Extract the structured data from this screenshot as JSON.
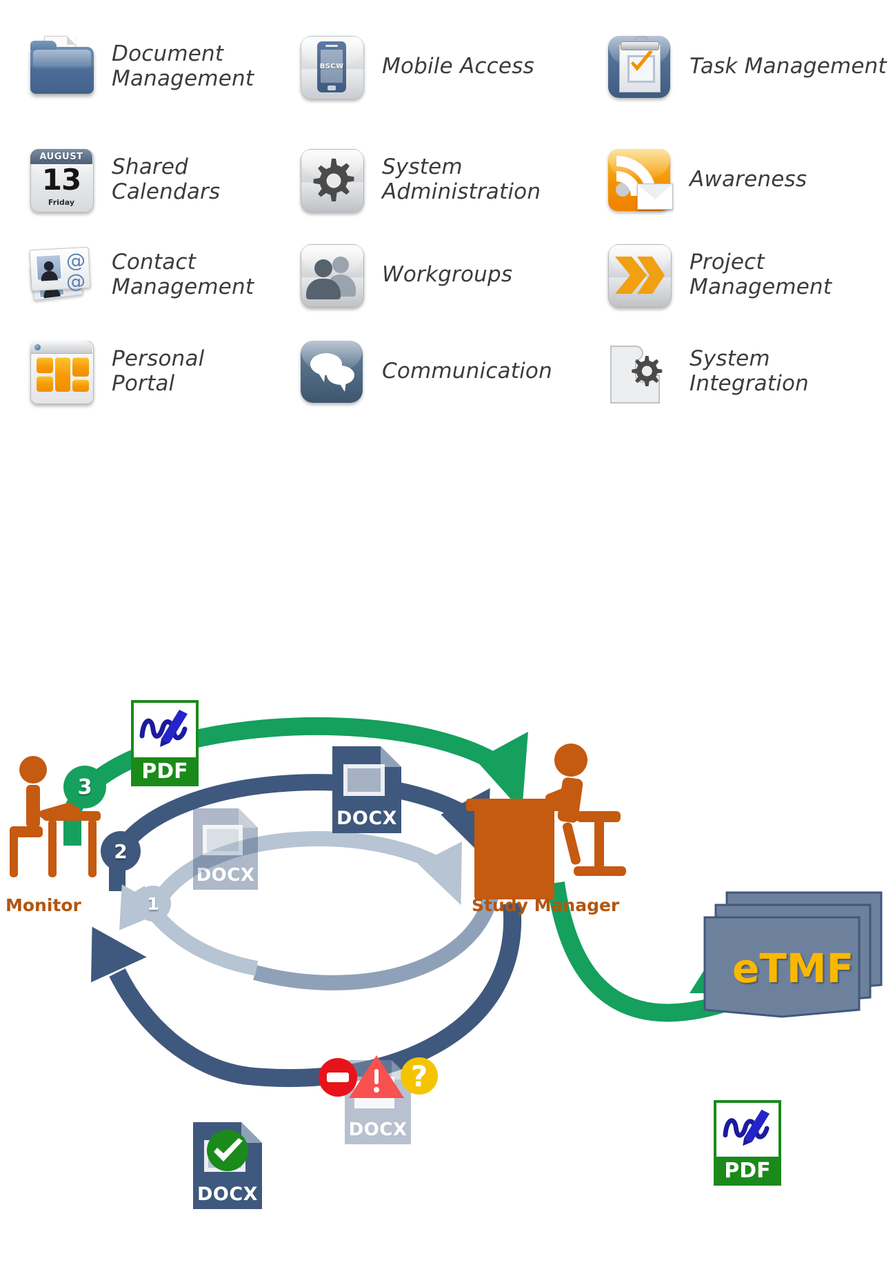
{
  "feature_grid": {
    "items": [
      {
        "id": "document-management",
        "icon": "folder-document-icon",
        "label": "Document\nManagement",
        "col": 0,
        "row": 0
      },
      {
        "id": "mobile-access",
        "icon": "mobile-phone-icon",
        "label": "Mobile Access",
        "col": 1,
        "row": 0,
        "device_brand": "BSCW"
      },
      {
        "id": "task-management",
        "icon": "clipboard-checkmark-icon",
        "label": "Task Management",
        "col": 2,
        "row": 0
      },
      {
        "id": "shared-calendars",
        "icon": "calendar-icon",
        "label": "Shared\nCalendars",
        "col": 0,
        "row": 1,
        "calendar": {
          "month": "AUGUST",
          "day": "13",
          "weekday": "Friday"
        }
      },
      {
        "id": "system-administration",
        "icon": "gear-icon",
        "label": "System\nAdministration",
        "col": 1,
        "row": 1
      },
      {
        "id": "awareness",
        "icon": "rss-envelope-icon",
        "label": "Awareness",
        "col": 2,
        "row": 1
      },
      {
        "id": "contact-management",
        "icon": "contact-cards-icon",
        "label": "Contact\nManagement",
        "col": 0,
        "row": 2,
        "at_symbol": "@"
      },
      {
        "id": "workgroups",
        "icon": "people-group-icon",
        "label": "Workgroups",
        "col": 1,
        "row": 2
      },
      {
        "id": "project-management",
        "icon": "chevrons-forward-icon",
        "label": "Project\nManagement",
        "col": 2,
        "row": 2
      },
      {
        "id": "personal-portal",
        "icon": "portal-window-icon",
        "label": "Personal\nPortal",
        "col": 0,
        "row": 3
      },
      {
        "id": "communication",
        "icon": "speech-bubbles-icon",
        "label": "Communication",
        "col": 1,
        "row": 3
      },
      {
        "id": "system-integration",
        "icon": "puzzle-gear-icon",
        "label": "System\nIntegration",
        "col": 2,
        "row": 3
      }
    ]
  },
  "process_diagram": {
    "actors": [
      {
        "id": "monitor",
        "label": "Monitor"
      },
      {
        "id": "study-manager",
        "label": "Study Manager"
      }
    ],
    "archive": {
      "id": "etmf-archive",
      "label": "eTMF"
    },
    "step_badges": [
      {
        "id": "step-1",
        "number": "1",
        "color": "#b6c4d3"
      },
      {
        "id": "step-2",
        "number": "2",
        "color": "#3f587d"
      },
      {
        "id": "step-3",
        "number": "3",
        "color": "#15a05e"
      }
    ],
    "documents": [
      {
        "id": "pdf-signed-top",
        "type": "PDF",
        "label": "PDF",
        "badge": "signature"
      },
      {
        "id": "docx-draft-inner",
        "type": "DOCX",
        "label": "DOCX",
        "badge": "none"
      },
      {
        "id": "docx-review",
        "type": "DOCX",
        "label": "DOCX",
        "badge": "none"
      },
      {
        "id": "docx-rejected",
        "type": "DOCX",
        "label": "DOCX",
        "badges": [
          "reject-icon",
          "warning-icon",
          "question-icon"
        ]
      },
      {
        "id": "docx-approved",
        "type": "DOCX",
        "label": "DOCX",
        "badges": [
          "check-icon"
        ]
      },
      {
        "id": "pdf-archived",
        "type": "PDF",
        "label": "PDF",
        "badge": "signature"
      }
    ],
    "colors": {
      "accent_orange": "#c55a11",
      "label_orange": "#b3560f",
      "dark_blue": "#3f587d",
      "light_blue": "#b6c4d3",
      "mid_blue": "#8fa1b8",
      "green": "#15a05e",
      "etmf_fill": "#6e819c",
      "etmf_text": "#fbb800",
      "docx_blue": "#3f587d",
      "pdf_green": "#1a8a1a"
    }
  }
}
